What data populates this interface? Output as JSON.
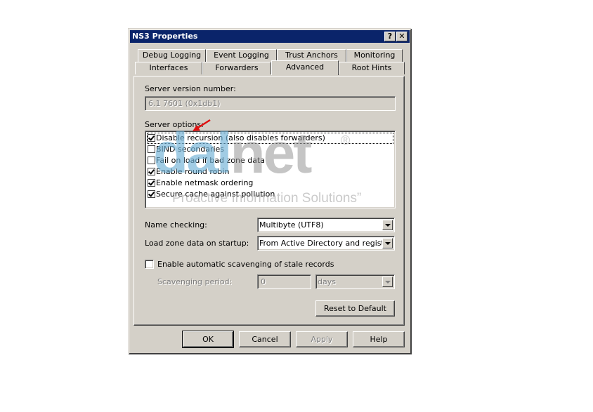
{
  "window": {
    "title": "NS3 Properties",
    "help_glyph": "?",
    "close_glyph": "✕"
  },
  "tabs": {
    "row1": [
      {
        "label": "Debug Logging"
      },
      {
        "label": "Event Logging"
      },
      {
        "label": "Trust Anchors"
      },
      {
        "label": "Monitoring"
      }
    ],
    "row2": [
      {
        "label": "Interfaces"
      },
      {
        "label": "Forwarders"
      },
      {
        "label": "Advanced",
        "active": true
      },
      {
        "label": "Root Hints"
      }
    ]
  },
  "advanced": {
    "server_version_label": "Server version number:",
    "server_version_value": "6.1 7601 (0x1db1)",
    "server_options_label": "Server options:",
    "options": [
      {
        "label": "Disable recursion (also disables forwarders)",
        "checked": true
      },
      {
        "label": "BIND secondaries",
        "checked": false
      },
      {
        "label": "Fail on load if bad zone data",
        "checked": false
      },
      {
        "label": "Enable round robin",
        "checked": true
      },
      {
        "label": "Enable netmask ordering",
        "checked": true
      },
      {
        "label": "Secure cache against pollution",
        "checked": true
      }
    ],
    "name_checking_label": "Name checking:",
    "name_checking_value": "Multibyte (UTF8)",
    "load_zone_label": "Load zone data on startup:",
    "load_zone_value": "From Active Directory and registry",
    "scavenging_label": "Enable automatic scavenging of stale records",
    "scavenging_checked": false,
    "scavenging_period_label": "Scavenging period:",
    "scavenging_period_value": "0",
    "scavenging_unit_value": "days",
    "reset_label": "Reset to Default"
  },
  "buttons": {
    "ok": "OK",
    "cancel": "Cancel",
    "apply": "Apply",
    "help": "Help"
  },
  "watermark": {
    "brand_part1": "dal",
    "brand_part2": "net",
    "registered": "®",
    "tagline": "Proactive Information Solutions”"
  },
  "colors": {
    "titlebar": "#0a246a",
    "face": "#d4d0c8",
    "annotation_arrow": "#e01010"
  }
}
